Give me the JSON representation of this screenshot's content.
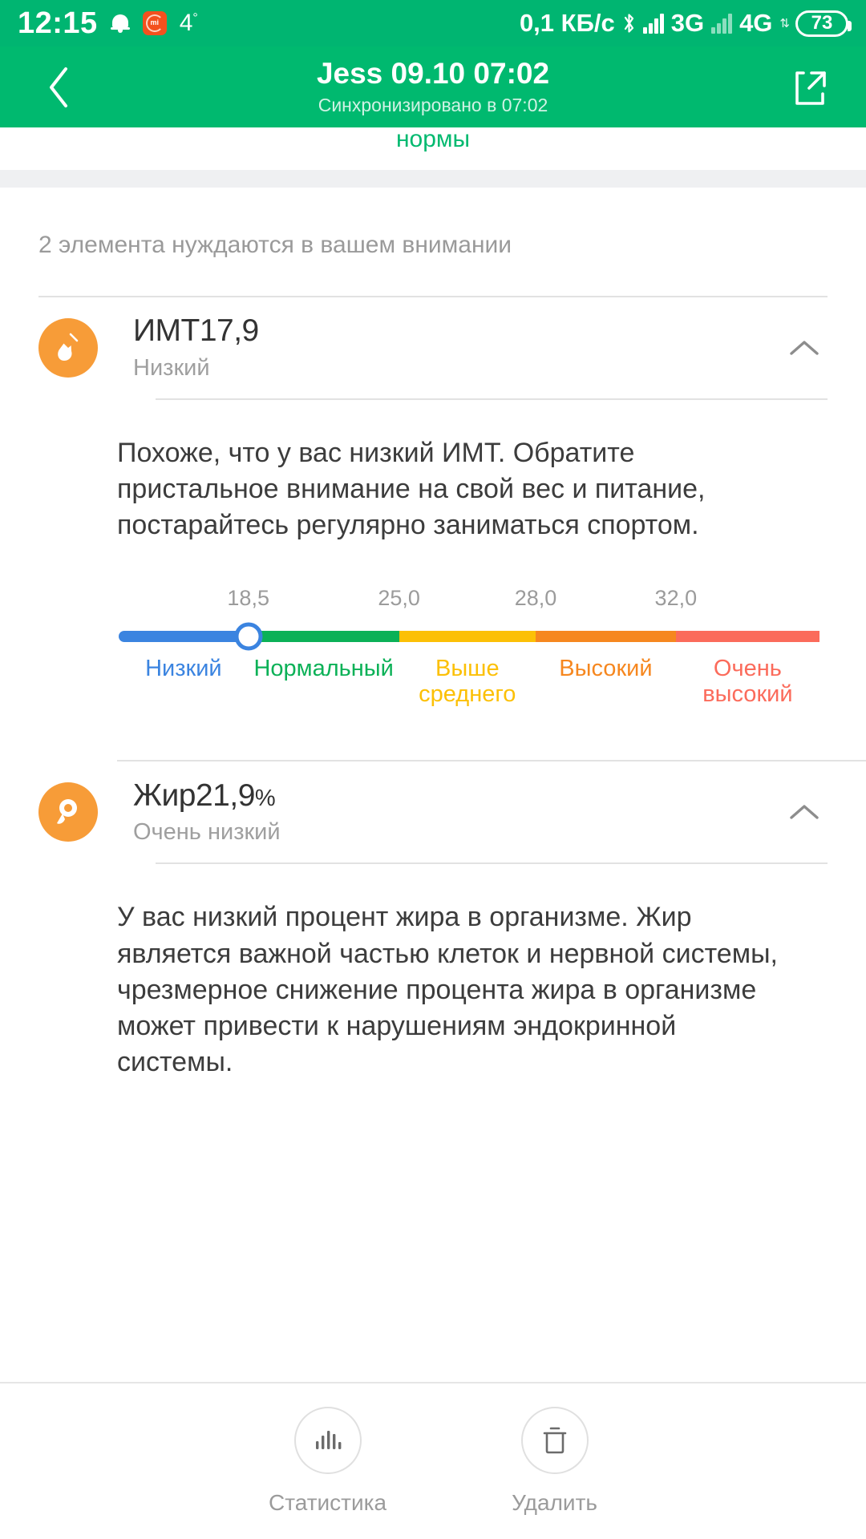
{
  "status_bar": {
    "time": "12:15",
    "temperature": "4",
    "degree_symbol": "°",
    "network_speed": "0,1 КБ/с",
    "network_3g": "3G",
    "network_4g": "4G",
    "battery": "73",
    "icons": {
      "bell": "notification-bell-icon",
      "app": "mi-fit-app-icon",
      "bluetooth": "bluetooth-icon",
      "signal": "signal-bars-icon"
    }
  },
  "app_bar": {
    "title": "Jess 09.10 07:02",
    "subtitle": "Синхронизировано в 07:02",
    "back_icon": "chevron-left-icon",
    "share_icon": "share-external-icon"
  },
  "norms_link": "нормы",
  "attention": {
    "text": "2 элемента нуждаются в вашем внимании"
  },
  "items": [
    {
      "title": "ИМТ17,9",
      "value_label": "ИМТ17,9",
      "status": "Низкий",
      "icon": "bmi-flask-icon",
      "chevron": "chevron-up-icon",
      "description": "Похоже, что у вас низкий ИМТ. Обратите пристальное внимание на свой вес и питание, постарайтесь регулярно заниматься спортом."
    },
    {
      "title": "Жир21,9",
      "unit": "%",
      "status": "Очень низкий",
      "icon": "fat-drop-icon",
      "chevron": "chevron-up-icon",
      "description": "У вас низкий процент жира в организме. Жир является важной частью клеток и нервной системы, чрезмерное снижение процента жира в организме может привести к нарушениям эндокринной системы."
    }
  ],
  "bottom_bar": {
    "buttons": [
      {
        "label": "Статистика",
        "icon": "bar-chart-icon"
      },
      {
        "label": "Удалить",
        "icon": "trash-icon"
      }
    ]
  },
  "chart_data": {
    "type": "bar",
    "title": "ИМТ (BMI) категории — шкала",
    "xlabel": "",
    "ylabel": "",
    "categories": [
      "Низкий",
      "Нормальный",
      "Выше среднего",
      "Высокий",
      "Очень высокий"
    ],
    "tick_labels": [
      "18,5",
      "25,0",
      "28,0",
      "32,0"
    ],
    "tick_values": [
      18.5,
      25.0,
      28.0,
      32.0
    ],
    "tick_positions_pct": [
      18.5,
      40.0,
      59.5,
      79.5
    ],
    "segment_widths_pct": [
      18.5,
      21.5,
      19.5,
      20.0,
      20.5
    ],
    "segment_colors": [
      "#3b84e0",
      "#0bb157",
      "#fcc006",
      "#f6871f",
      "#fb6b5b"
    ],
    "legend_colors": [
      "#3b84e0",
      "#0bb157",
      "#fcc006",
      "#f6871f",
      "#fb6b5b"
    ],
    "legend_labels": [
      "Низкий",
      "Нормал ьный",
      "Выше среднег о",
      "Высокий",
      "Очень высокий"
    ],
    "current_value": 17.9,
    "marker_position_pct": 18.5,
    "marker_color": "#3b84e0",
    "grid": false,
    "legend_position": "bottom"
  }
}
